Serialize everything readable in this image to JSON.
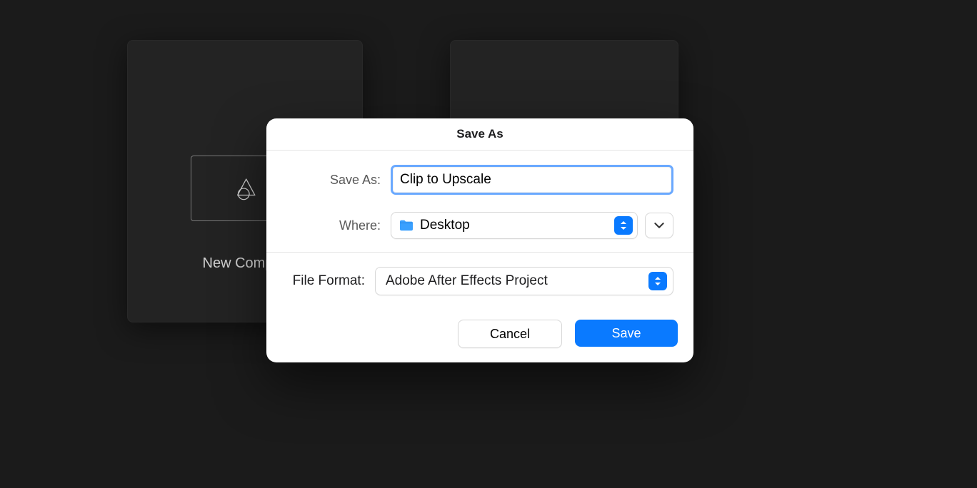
{
  "background": {
    "left_card_label": "New Comp…"
  },
  "dialog": {
    "title": "Save As",
    "save_as_label": "Save As:",
    "filename_value": "Clip to Upscale",
    "where_label": "Where:",
    "where_value": "Desktop",
    "file_format_label": "File Format:",
    "file_format_value": "Adobe After Effects Project",
    "cancel_label": "Cancel",
    "save_label": "Save"
  }
}
